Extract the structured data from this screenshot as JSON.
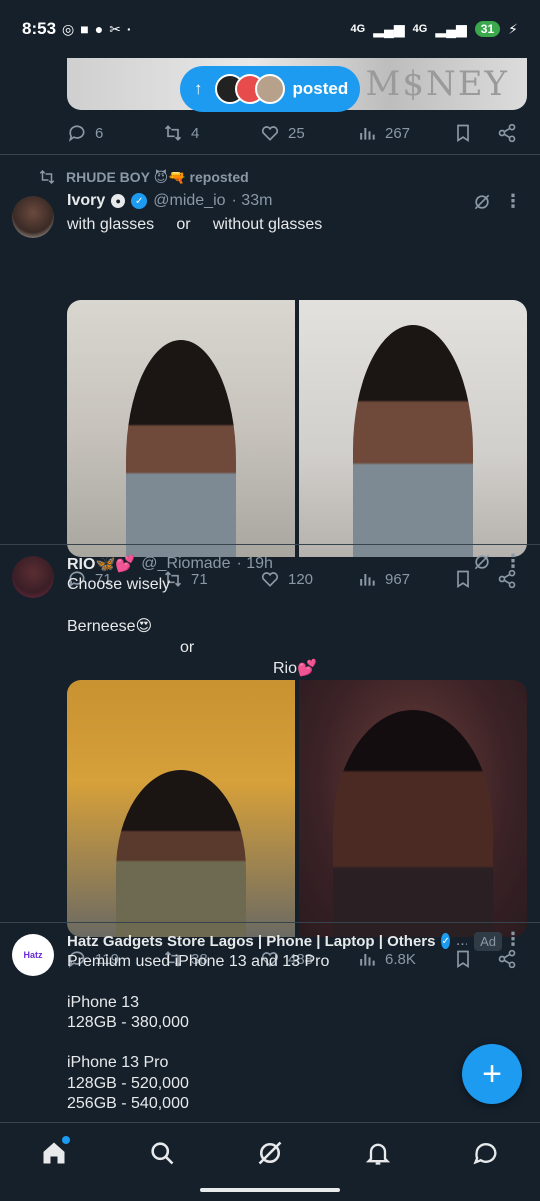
{
  "status": {
    "time": "8:53",
    "signal1": "4G",
    "signal2": "4G",
    "battery": "31"
  },
  "top_tweet": {
    "pill_label": "posted",
    "reply": "6",
    "retweet": "4",
    "like": "25",
    "views": "267",
    "watermark": "M$NEY"
  },
  "tweet1": {
    "repost_by": "RHUDE BOY 😈🔫 reposted",
    "name": "Ivory",
    "handle": "@mide_io",
    "time": "· 33m",
    "text_left": "with glasses",
    "text_mid": "or",
    "text_right": "without glasses",
    "reply": "71",
    "retweet": "71",
    "like": "120",
    "views": "967"
  },
  "tweet2": {
    "name": "RIO🦋💕",
    "handle": "@_Riomade",
    "time": "· 19h",
    "line1": "Choose wisely",
    "opt1": "Berneese😍",
    "opt_or": "or",
    "opt2": "Rio💕",
    "reply": "119",
    "retweet": "38",
    "like": "488",
    "views": "6.8K"
  },
  "ad": {
    "name": "Hatz Gadgets Store Lagos | Phone | Laptop | Others",
    "ellipsis": "...",
    "tag": "Ad",
    "logo": "Hatz",
    "body": "Premium used iPhone 13 and 13 Pro\n\niPhone 13\n128GB - 380,000\n\niPhone 13 Pro\n128GB - 520,000\n256GB - 540,000"
  },
  "fab": "+",
  "icons": {
    "reply": "reply-icon",
    "retweet": "retweet-icon",
    "like": "heart-icon",
    "views": "views-icon",
    "bookmark": "bookmark-icon",
    "share": "share-icon",
    "grok": "grok-icon",
    "more": "more-icon"
  },
  "colors": {
    "bg": "#15202b",
    "accent": "#1d9bf0",
    "muted": "#8b98a5",
    "text": "#e7e9ea"
  }
}
